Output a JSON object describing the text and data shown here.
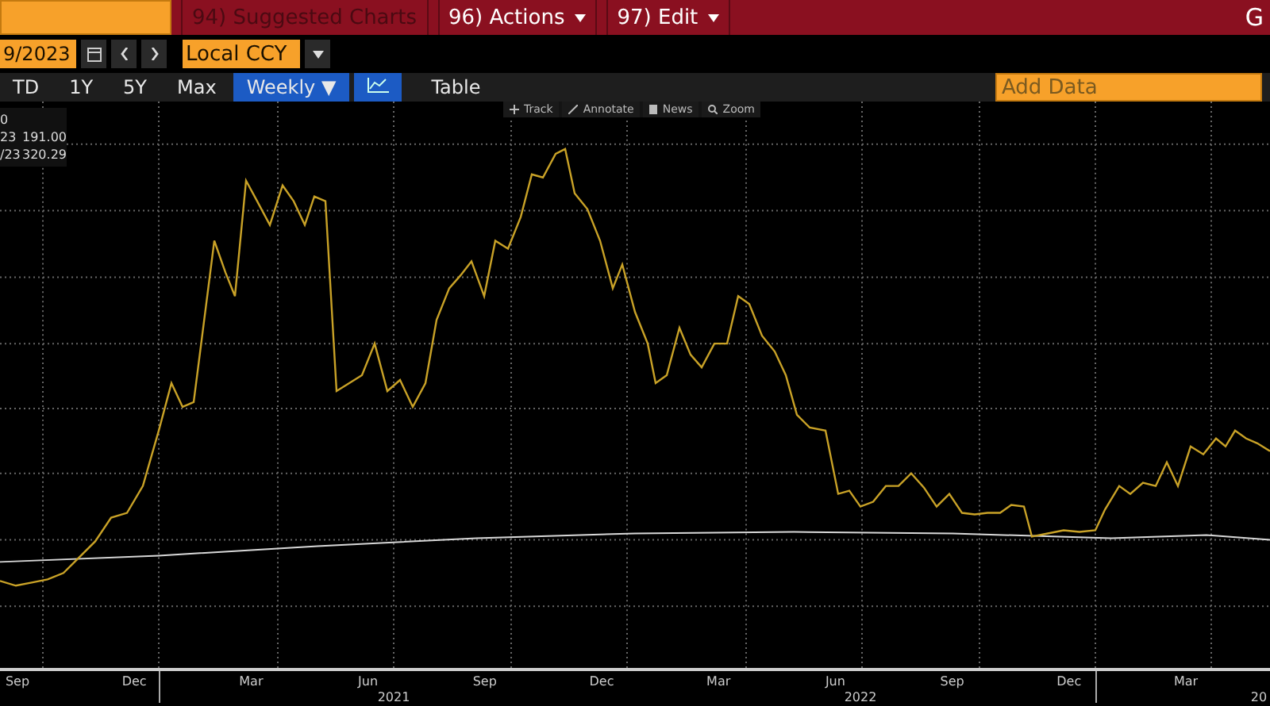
{
  "top_bar": {
    "items": [
      {
        "label": "94) Suggested Charts",
        "disabled": true,
        "dropdown": false
      },
      {
        "label": "96) Actions",
        "disabled": false,
        "dropdown": true
      },
      {
        "label": "97) Edit",
        "disabled": false,
        "dropdown": true
      }
    ],
    "right_label": "G"
  },
  "controls": {
    "date_field": "9/2023",
    "currency_field": "Local CCY"
  },
  "periods": [
    {
      "label": "TD",
      "selected": false
    },
    {
      "label": "1Y",
      "selected": false
    },
    {
      "label": "5Y",
      "selected": false
    },
    {
      "label": "Max",
      "selected": false
    }
  ],
  "frequency_button": {
    "label": "Weekly ▼",
    "selected": true
  },
  "chart_type_button": {
    "selected": true
  },
  "table_button": {
    "label": "Table",
    "selected": false
  },
  "add_data": {
    "placeholder": "Add Data"
  },
  "chart_tools": [
    {
      "kind": "track",
      "label": "Track"
    },
    {
      "kind": "annotate",
      "label": "Annotate"
    },
    {
      "kind": "news",
      "label": "News"
    },
    {
      "kind": "zoom",
      "label": "Zoom"
    }
  ],
  "legend": [
    {
      "label": "0"
    },
    {
      "label": "23",
      "value": "191.00"
    },
    {
      "label": "/23",
      "value": "320.29"
    }
  ],
  "lines": [
    {
      "color": "#c9a227"
    },
    {
      "color": "#d8d8d8"
    }
  ],
  "x_axis": {
    "months": [
      "Sep",
      "Dec",
      "Mar",
      "Jun",
      "Sep",
      "Dec",
      "Mar",
      "Jun",
      "Sep",
      "Dec",
      "Mar"
    ],
    "years": [
      "2021",
      "2022",
      "20"
    ]
  }
}
